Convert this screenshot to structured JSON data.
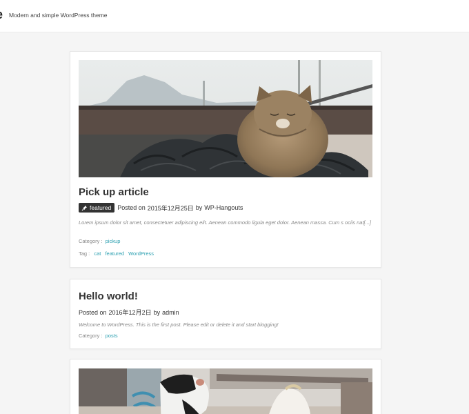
{
  "site": {
    "title": "e",
    "description": "Modern and simple WordPress theme"
  },
  "posts": [
    {
      "title": "Pick up article",
      "badge": "featured",
      "posted_on": "Posted on",
      "date": "2015年12月25日",
      "by": "by",
      "author": "WP-Hangouts",
      "excerpt": "Lorem ipsum dolor sit amet, consectetuer adipiscing elit. Aenean commodo ligula eget dolor. Aenean massa. Cum s ociis nat[...]",
      "category_label": "Category :",
      "category": "pickup",
      "tag_label": "Tag :",
      "tags": [
        "cat",
        "featured",
        "WordPress"
      ],
      "thumbnail_icon": "cat-photo"
    },
    {
      "title": "Hello world!",
      "posted_on": "Posted on",
      "date": "2016年12月2日",
      "by": "by",
      "author": "admin",
      "excerpt": "Welcome to WordPress. This is the first post. Please edit or delete it and start blogging!",
      "category_label": "Category :",
      "category": "posts"
    },
    {
      "thumbnail_icon": "cats-photo"
    }
  ],
  "colors": {
    "accent": "#2a9fb0",
    "badge_bg": "#333333",
    "page_bg": "#f5f5f5"
  }
}
